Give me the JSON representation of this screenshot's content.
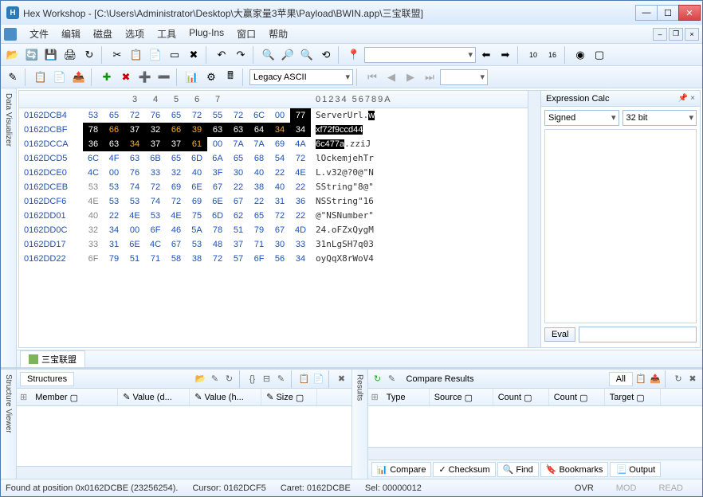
{
  "title": "Hex Workshop - [C:\\Users\\Administrator\\Desktop\\大赢家量3苹果\\Payload\\BWIN.app\\三宝联盟]",
  "menu": [
    "文件",
    "编辑",
    "磁盘",
    "选项",
    "工具",
    "Plug-Ins",
    "窗口",
    "帮助"
  ],
  "encoding": "Legacy ASCII",
  "datavis_label": "Data Visualizer",
  "hex_cols": [
    "3",
    "4",
    "5",
    "6",
    "7"
  ],
  "hex_asc_header": "01234 56789A",
  "hex_rows": [
    {
      "addr": "0162DCB4",
      "bytes": [
        {
          "v": "53"
        },
        {
          "v": "65"
        },
        {
          "v": "72"
        },
        {
          "v": "76"
        },
        {
          "v": "65"
        },
        {
          "v": "72"
        },
        {
          "v": "55"
        },
        {
          "v": "72"
        },
        {
          "v": "6C"
        },
        {
          "v": "00"
        },
        {
          "v": "77",
          "c": "sel"
        }
      ],
      "asc": "ServerUrl.",
      "sel": "w"
    },
    {
      "addr": "0162DCBF",
      "bytes": [
        {
          "v": "78",
          "c": "sel"
        },
        {
          "v": "66",
          "c": "hl"
        },
        {
          "v": "37",
          "c": "sel"
        },
        {
          "v": "32",
          "c": "sel"
        },
        {
          "v": "66",
          "c": "hl"
        },
        {
          "v": "39",
          "c": "hl"
        },
        {
          "v": "63",
          "c": "sel"
        },
        {
          "v": "63",
          "c": "sel"
        },
        {
          "v": "64",
          "c": "sel"
        },
        {
          "v": "34",
          "c": "hl"
        },
        {
          "v": "34",
          "c": "sel"
        }
      ],
      "asc": "",
      "sel": "xf72f9ccd44"
    },
    {
      "addr": "0162DCCA",
      "bytes": [
        {
          "v": "36",
          "c": "sel"
        },
        {
          "v": "63",
          "c": "sel"
        },
        {
          "v": "34",
          "c": "hl"
        },
        {
          "v": "37",
          "c": "sel"
        },
        {
          "v": "37",
          "c": "sel"
        },
        {
          "v": "61",
          "c": "hl"
        },
        {
          "v": "00"
        },
        {
          "v": "7A"
        },
        {
          "v": "7A"
        },
        {
          "v": "69"
        },
        {
          "v": "4A"
        }
      ],
      "asc": ".zziJ",
      "sel": "6c477a",
      "pre": true
    },
    {
      "addr": "0162DCD5",
      "bytes": [
        {
          "v": "6C"
        },
        {
          "v": "4F"
        },
        {
          "v": "63"
        },
        {
          "v": "6B"
        },
        {
          "v": "65"
        },
        {
          "v": "6D"
        },
        {
          "v": "6A"
        },
        {
          "v": "65"
        },
        {
          "v": "68"
        },
        {
          "v": "54"
        },
        {
          "v": "72"
        }
      ],
      "asc": "lOckemjehTr"
    },
    {
      "addr": "0162DCE0",
      "bytes": [
        {
          "v": "4C"
        },
        {
          "v": "00"
        },
        {
          "v": "76"
        },
        {
          "v": "33"
        },
        {
          "v": "32"
        },
        {
          "v": "40"
        },
        {
          "v": "3F"
        },
        {
          "v": "30"
        },
        {
          "v": "40"
        },
        {
          "v": "22"
        },
        {
          "v": "4E"
        }
      ],
      "asc": "L.v32@?0@\"N"
    },
    {
      "addr": "0162DCEB",
      "bytes": [
        {
          "v": "53",
          "c": "gr"
        },
        {
          "v": "53"
        },
        {
          "v": "74"
        },
        {
          "v": "72"
        },
        {
          "v": "69"
        },
        {
          "v": "6E"
        },
        {
          "v": "67"
        },
        {
          "v": "22"
        },
        {
          "v": "38"
        },
        {
          "v": "40"
        },
        {
          "v": "22"
        }
      ],
      "asc": "SString\"8@\""
    },
    {
      "addr": "0162DCF6",
      "bytes": [
        {
          "v": "4E",
          "c": "gr"
        },
        {
          "v": "53"
        },
        {
          "v": "53"
        },
        {
          "v": "74"
        },
        {
          "v": "72"
        },
        {
          "v": "69"
        },
        {
          "v": "6E"
        },
        {
          "v": "67"
        },
        {
          "v": "22"
        },
        {
          "v": "31"
        },
        {
          "v": "36"
        }
      ],
      "asc": "NSString\"16"
    },
    {
      "addr": "0162DD01",
      "bytes": [
        {
          "v": "40",
          "c": "gr"
        },
        {
          "v": "22"
        },
        {
          "v": "4E"
        },
        {
          "v": "53"
        },
        {
          "v": "4E"
        },
        {
          "v": "75"
        },
        {
          "v": "6D"
        },
        {
          "v": "62"
        },
        {
          "v": "65"
        },
        {
          "v": "72"
        },
        {
          "v": "22"
        }
      ],
      "asc": "@\"NSNumber\""
    },
    {
      "addr": "0162DD0C",
      "bytes": [
        {
          "v": "32",
          "c": "gr"
        },
        {
          "v": "34"
        },
        {
          "v": "00"
        },
        {
          "v": "6F"
        },
        {
          "v": "46"
        },
        {
          "v": "5A"
        },
        {
          "v": "78"
        },
        {
          "v": "51"
        },
        {
          "v": "79"
        },
        {
          "v": "67"
        },
        {
          "v": "4D"
        }
      ],
      "asc": "24.oFZxQygM"
    },
    {
      "addr": "0162DD17",
      "bytes": [
        {
          "v": "33",
          "c": "gr"
        },
        {
          "v": "31"
        },
        {
          "v": "6E"
        },
        {
          "v": "4C"
        },
        {
          "v": "67"
        },
        {
          "v": "53"
        },
        {
          "v": "48"
        },
        {
          "v": "37"
        },
        {
          "v": "71"
        },
        {
          "v": "30"
        },
        {
          "v": "33"
        }
      ],
      "asc": "31nLgSH7q03"
    },
    {
      "addr": "0162DD22",
      "bytes": [
        {
          "v": "6F",
          "c": "gr"
        },
        {
          "v": "79"
        },
        {
          "v": "51"
        },
        {
          "v": "71"
        },
        {
          "v": "58"
        },
        {
          "v": "38"
        },
        {
          "v": "72"
        },
        {
          "v": "57"
        },
        {
          "v": "6F"
        },
        {
          "v": "56"
        },
        {
          "v": "34"
        }
      ],
      "asc": "oyQqX8rWoV4"
    }
  ],
  "expr": {
    "title": "Expression Calc",
    "signed": "Signed",
    "bits": "32 bit",
    "eval": "Eval"
  },
  "filetab": "三宝联盟",
  "structures": {
    "title": "Structures",
    "cols": [
      "Member",
      "Value (d...",
      "Value (h...",
      "Size"
    ]
  },
  "compare": {
    "title": "Compare Results",
    "all": "All",
    "cols": [
      "Type",
      "Source",
      "Count",
      "Count",
      "Target"
    ],
    "tabs": [
      "Compare",
      "Checksum",
      "Find",
      "Bookmarks",
      "Output"
    ]
  },
  "sidelabels": {
    "struct": "Structure Viewer",
    "res": "Results"
  },
  "status": {
    "found": "Found at position 0x0162DCBE (23256254).",
    "cursor": "Cursor: 0162DCF5",
    "caret": "Caret: 0162DCBE",
    "sel": "Sel: 00000012",
    "ovr": "OVR",
    "mod": "MOD",
    "read": "READ"
  }
}
